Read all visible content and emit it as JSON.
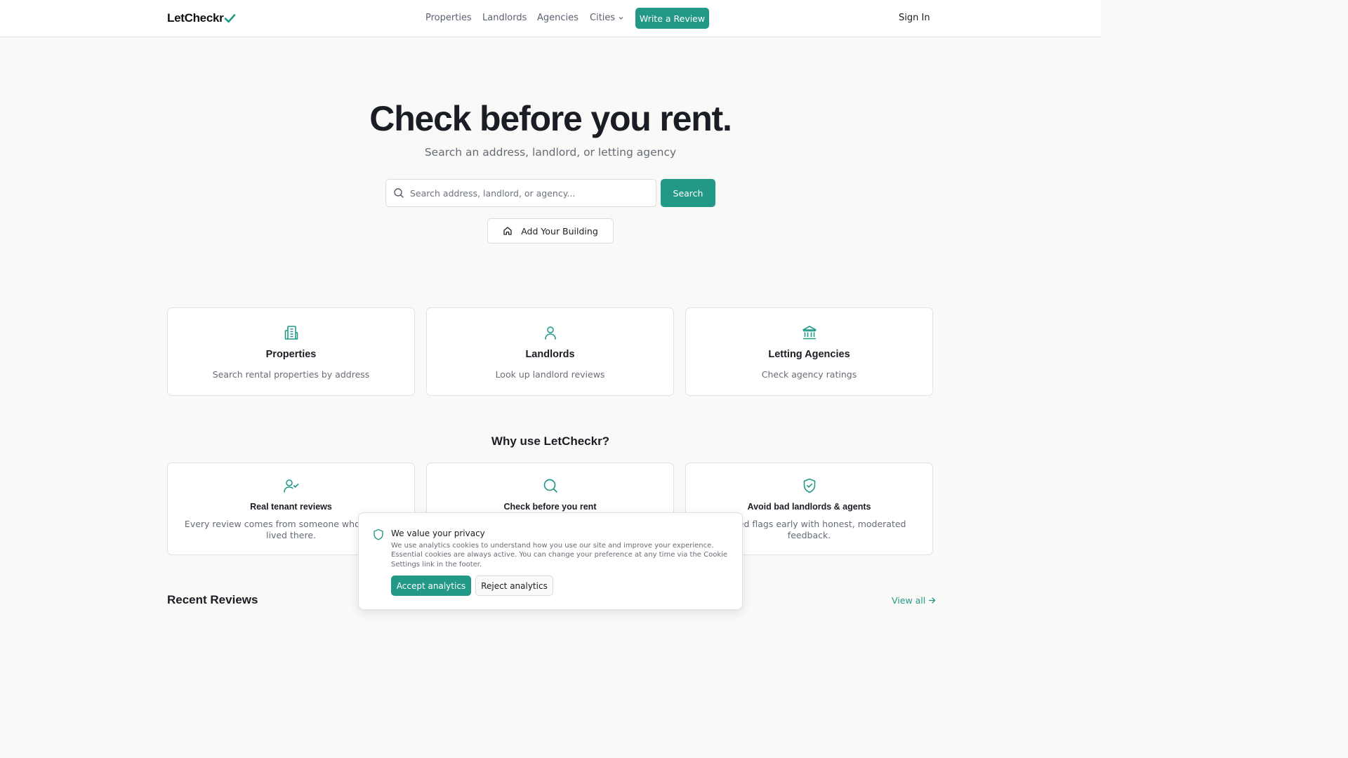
{
  "brand": {
    "name": "LetCheckr",
    "accent": "#229987",
    "logo_icon": "checkmark-icon"
  },
  "nav": {
    "items": [
      {
        "label": "Properties"
      },
      {
        "label": "Landlords"
      },
      {
        "label": "Agencies"
      },
      {
        "label": "Cities"
      }
    ],
    "cta_label": "Write a Review",
    "signin_label": "Sign In"
  },
  "hero": {
    "title": "Check before you rent.",
    "subtitle": "Search an address, landlord, or letting agency",
    "search_placeholder": "Search address, landlord, or agency...",
    "search_button": "Search",
    "add_building_label": "Add Your Building"
  },
  "categories": [
    {
      "icon": "building-icon",
      "title": "Properties",
      "desc": "Search rental properties by address"
    },
    {
      "icon": "user-icon",
      "title": "Landlords",
      "desc": "Look up landlord reviews"
    },
    {
      "icon": "bank-icon",
      "title": "Letting Agencies",
      "desc": "Check agency ratings"
    }
  ],
  "why": {
    "title": "Why use LetCheckr?",
    "items": [
      {
        "icon": "user-check-icon",
        "title": "Real tenant reviews",
        "desc": "Every review comes from someone who actually lived there."
      },
      {
        "icon": "search-icon",
        "title": "Check before you rent",
        "desc": ""
      },
      {
        "icon": "shield-check-icon",
        "title": "Avoid bad landlords & agents",
        "desc": "Spot red flags early with honest, moderated feedback."
      }
    ]
  },
  "recent": {
    "title": "Recent Reviews",
    "view_all": "View all"
  },
  "cookie": {
    "title": "We value your privacy",
    "text": "We use analytics cookies to understand how you use our site and improve your experience. Essential cookies are always active. You can change your preference at any time via the Cookie Settings link in the footer.",
    "accept_label": "Accept analytics",
    "reject_label": "Reject analytics"
  }
}
